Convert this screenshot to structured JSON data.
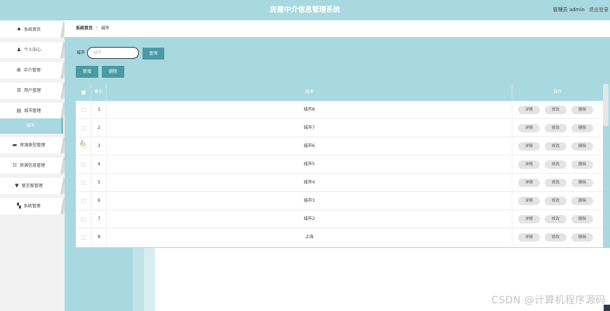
{
  "app": {
    "title": "房屋中介信息管理系统",
    "user_label": "管理员 admin",
    "logout_label": "退出登录"
  },
  "colors": {
    "accent": "#a9d9e0",
    "button": "#4b9aa3",
    "op_button": "#e4e4e4"
  },
  "sidebar": {
    "items": [
      {
        "label": "系统首页",
        "icon": "home-icon",
        "glyph": "♠"
      },
      {
        "label": "个人中心",
        "icon": "user-icon",
        "glyph": "♟"
      },
      {
        "label": "中介管理",
        "icon": "grid-icon",
        "glyph": "⊞"
      },
      {
        "label": "用户管理",
        "icon": "list-icon",
        "glyph": "☰"
      },
      {
        "label": "城市管理",
        "icon": "building-icon",
        "glyph": "▤"
      },
      {
        "label": "房源类型管理",
        "icon": "briefcase-icon",
        "glyph": "▬"
      },
      {
        "label": "房源信息管理",
        "icon": "list-icon",
        "glyph": "☷"
      },
      {
        "label": "留言板管理",
        "icon": "trophy-icon",
        "glyph": "▼"
      },
      {
        "label": "系统管理",
        "icon": "apps-icon",
        "glyph": "▚"
      }
    ],
    "active_sub": "城市"
  },
  "breadcrumb": {
    "home": "系统首页",
    "separator": "Ξ",
    "current": "城市"
  },
  "search": {
    "label": "城市",
    "placeholder": "城市",
    "value": "",
    "query_button": "查询"
  },
  "actions": {
    "add_button": "新增",
    "delete_button": "删除"
  },
  "table": {
    "columns": [
      "索引",
      "城市",
      "操作"
    ],
    "rows": [
      {
        "index": "1",
        "city": "城市8"
      },
      {
        "index": "2",
        "city": "城市7"
      },
      {
        "index": "3",
        "city": "城市6"
      },
      {
        "index": "4",
        "city": "城市5"
      },
      {
        "index": "5",
        "city": "城市4"
      },
      {
        "index": "6",
        "city": "城市3"
      },
      {
        "index": "7",
        "city": "城市2"
      },
      {
        "index": "8",
        "city": "上海"
      }
    ],
    "row_actions": {
      "detail": "详情",
      "edit": "修改",
      "delete": "删除"
    }
  },
  "watermark": "CSDN @计算机程序源码"
}
